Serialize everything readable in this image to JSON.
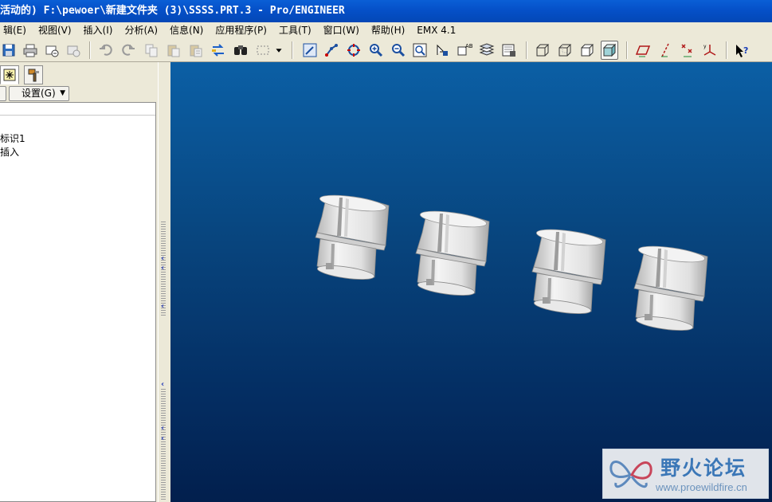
{
  "window": {
    "title": "活动的) F:\\pewoer\\新建文件夹 (3)\\SSSS.PRT.3 - Pro/ENGINEER"
  },
  "menubar": {
    "items": [
      {
        "label": "辑(E)"
      },
      {
        "label": "视图(V)"
      },
      {
        "label": "插入(I)"
      },
      {
        "label": "分析(A)"
      },
      {
        "label": "信息(N)"
      },
      {
        "label": "应用程序(P)"
      },
      {
        "label": "工具(T)"
      },
      {
        "label": "窗口(W)"
      },
      {
        "label": "帮助(H)"
      },
      {
        "label": "EMX 4.1"
      }
    ]
  },
  "toolbar": {
    "icons": [
      "save-icon",
      "print-icon",
      "send-icon",
      "mail-icon",
      "undo-icon",
      "redo-icon",
      "copy-icon",
      "paste-icon",
      "paste-special-icon",
      "regenerate-icon",
      "find-icon",
      "select-box-icon",
      "dropdown-arrow-icon",
      "repaint-icon",
      "spin-center-icon",
      "orient-icon",
      "zoom-in-icon",
      "zoom-out-icon",
      "refit-icon",
      "reorient-icon",
      "saved-views-icon",
      "layers-icon",
      "view-manager-icon",
      "wireframe-icon",
      "hidden-line-icon",
      "no-hidden-icon",
      "shading-icon",
      "datum-planes-icon",
      "datum-axes-icon",
      "datum-points-icon",
      "coordinate-systems-icon",
      "context-help-icon"
    ]
  },
  "leftpanel": {
    "settings_label": "设置(G)",
    "tree": [
      {
        "label": "标识1"
      },
      {
        "label": "插入"
      }
    ]
  },
  "watermark": {
    "title": "野火论坛",
    "url": "www.proewildfire.cn"
  },
  "colors": {
    "titlebar": "#0550c8",
    "chrome": "#ece9d8",
    "viewport_top": "#0b5fa5",
    "viewport_bottom": "#021f4d",
    "model": "#e4e4e4"
  }
}
